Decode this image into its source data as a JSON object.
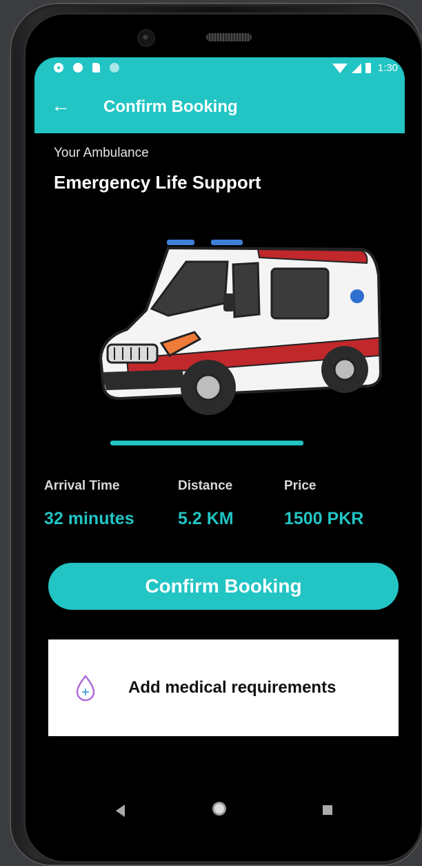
{
  "status_bar": {
    "time": "1:30"
  },
  "app_bar": {
    "title": "Confirm Booking",
    "back_icon": "arrow-left-icon"
  },
  "ambulance": {
    "label": "Your Ambulance",
    "name": "Emergency Life Support",
    "image": "ambulance-van-illustration"
  },
  "progress": {
    "fraction": 1.0
  },
  "stats": [
    {
      "label": "Arrival Time",
      "value": "32 minutes"
    },
    {
      "label": "Distance",
      "value": "5.2 KM"
    },
    {
      "label": "Price",
      "value": "1500 PKR"
    }
  ],
  "confirm_button": {
    "label": "Confirm Booking"
  },
  "medical_card": {
    "label": "Add medical requirements",
    "icon": "drop-plus-icon"
  },
  "colors": {
    "accent": "#22c4c4",
    "background": "#000000",
    "card": "#ffffff"
  }
}
